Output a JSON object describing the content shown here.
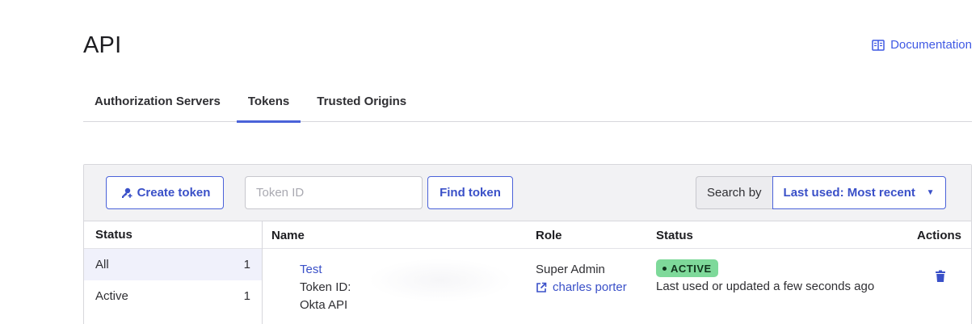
{
  "header": {
    "title": "API",
    "doc_link": "Documentation"
  },
  "tabs": [
    {
      "label": "Authorization Servers",
      "active": false
    },
    {
      "label": "Tokens",
      "active": true
    },
    {
      "label": "Trusted Origins",
      "active": false
    }
  ],
  "toolbar": {
    "create_label": "Create token",
    "token_placeholder": "Token ID",
    "find_label": "Find token",
    "search_by_label": "Search by",
    "search_by_value": "Last used: Most recent"
  },
  "sidebar": {
    "heading": "Status",
    "items": [
      {
        "label": "All",
        "count": "1"
      },
      {
        "label": "Active",
        "count": "1"
      }
    ]
  },
  "table": {
    "columns": {
      "name": "Name",
      "role": "Role",
      "status": "Status",
      "actions": "Actions"
    },
    "rows": [
      {
        "name": "Test",
        "token_id_label": "Token ID:",
        "source": "Okta API",
        "role": "Super Admin",
        "user": "charles porter",
        "status_badge": "ACTIVE",
        "status_note": "Last used or updated a few seconds ago"
      }
    ]
  },
  "colors": {
    "accent": "#4a62d9",
    "link": "#3a50c8",
    "badge_active": "#7ed99a"
  },
  "icons": [
    "book-icon",
    "add-key-icon",
    "external-link-icon",
    "trash-icon",
    "caret-down-icon"
  ]
}
